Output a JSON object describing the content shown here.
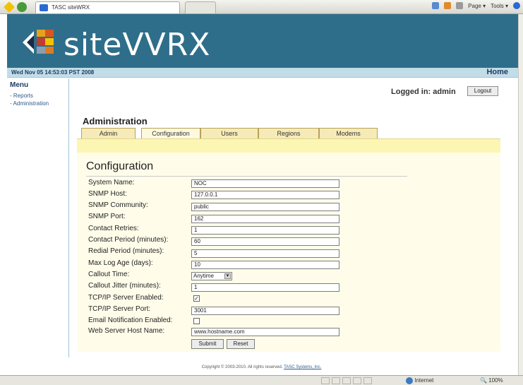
{
  "browser": {
    "tab_title": "TASC siteWRX",
    "toolbar": [
      "Page ▾",
      "Tools ▾"
    ]
  },
  "banner": {
    "logo_text": "siteVVRX"
  },
  "datebar": {
    "datetime": "Wed Nov 05 14:53:03 PST 2008",
    "home_link": "Home"
  },
  "menu": {
    "title": "Menu",
    "items": [
      "- Reports",
      "- Administration"
    ]
  },
  "session": {
    "logged_in": "Logged in: admin",
    "logout_label": "Logout"
  },
  "admin": {
    "heading": "Administration",
    "tabs": [
      "Admin",
      "Configuration",
      "Users",
      "Regions",
      "Modems"
    ],
    "active_tab": "Configuration"
  },
  "config": {
    "title": "Configuration",
    "fields": {
      "system_name": {
        "label": "System Name:",
        "value": "NOC"
      },
      "snmp_host": {
        "label": "SNMP Host:",
        "value": "127.0.0.1"
      },
      "snmp_community": {
        "label": "SNMP Community:",
        "value": "public"
      },
      "snmp_port": {
        "label": "SNMP Port:",
        "value": "162"
      },
      "contact_retries": {
        "label": "Contact Retries:",
        "value": "1"
      },
      "contact_period": {
        "label": "Contact Period (minutes):",
        "value": "60"
      },
      "redial_period": {
        "label": "Redial Period (minutes):",
        "value": "5"
      },
      "max_log_age": {
        "label": "Max Log Age (days):",
        "value": "10"
      },
      "callout_time": {
        "label": "Callout Time:",
        "value": "Anytime"
      },
      "callout_jitter": {
        "label": "Callout Jitter (minutes):",
        "value": "1"
      },
      "tcpip_enabled": {
        "label": "TCP/IP Server Enabled:",
        "checked": true
      },
      "tcpip_port": {
        "label": "TCP/IP Server Port:",
        "value": "3001"
      },
      "email_enabled": {
        "label": "Email Notification Enabled:",
        "checked": false
      },
      "web_host": {
        "label": "Web Server Host Name:",
        "value": "www.hostname.com"
      }
    },
    "submit_label": "Submit",
    "reset_label": "Reset"
  },
  "footer": {
    "copyright": "Copyright © 2003-2010. All rights reserved.",
    "company_link": "TASC Systems, Inc."
  },
  "status": {
    "zone": "Internet",
    "zoom": "100%"
  },
  "colors": {
    "banner": "#2f6e8a",
    "datebar": "#c2dde8",
    "panel": "#fffdea",
    "tab": "#f6ebb8"
  }
}
